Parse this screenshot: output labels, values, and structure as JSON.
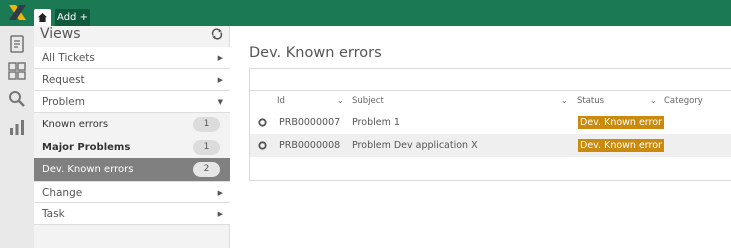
{
  "topbar": {
    "add_tab_label": "Add +",
    "colors": {
      "bar": "#1b7a53",
      "active_tab": "#ffffff",
      "add_tab": "#0f5a3d"
    }
  },
  "rail": {
    "icons": [
      "document-icon",
      "dashboard-grid-icon",
      "search-icon",
      "bar-chart-icon"
    ]
  },
  "views": {
    "title": "Views",
    "items": [
      {
        "label": "All Tickets",
        "arrow": "▶"
      },
      {
        "label": "Request",
        "arrow": "▶"
      },
      {
        "label": "Problem",
        "arrow": "▼"
      }
    ],
    "problem_subitems": [
      {
        "label": "Known errors",
        "count": "1"
      },
      {
        "label": "Major Problems",
        "count": "1"
      },
      {
        "label": "Dev. Known errors",
        "count": "2"
      }
    ],
    "items_after": [
      {
        "label": "Change",
        "arrow": "▶"
      },
      {
        "label": "Task",
        "arrow": "▶"
      }
    ]
  },
  "main": {
    "page_title": "Dev. Known errors",
    "columns": [
      "Id",
      "Subject",
      "Status",
      "Category"
    ],
    "rows": [
      {
        "id": "PRB0000007",
        "subject": "Problem 1",
        "status": "Dev. Known error"
      },
      {
        "id": "PRB0000008",
        "subject": "Problem Dev application X",
        "status": "Dev. Known error"
      }
    ],
    "status_color": "#c98a0e"
  }
}
